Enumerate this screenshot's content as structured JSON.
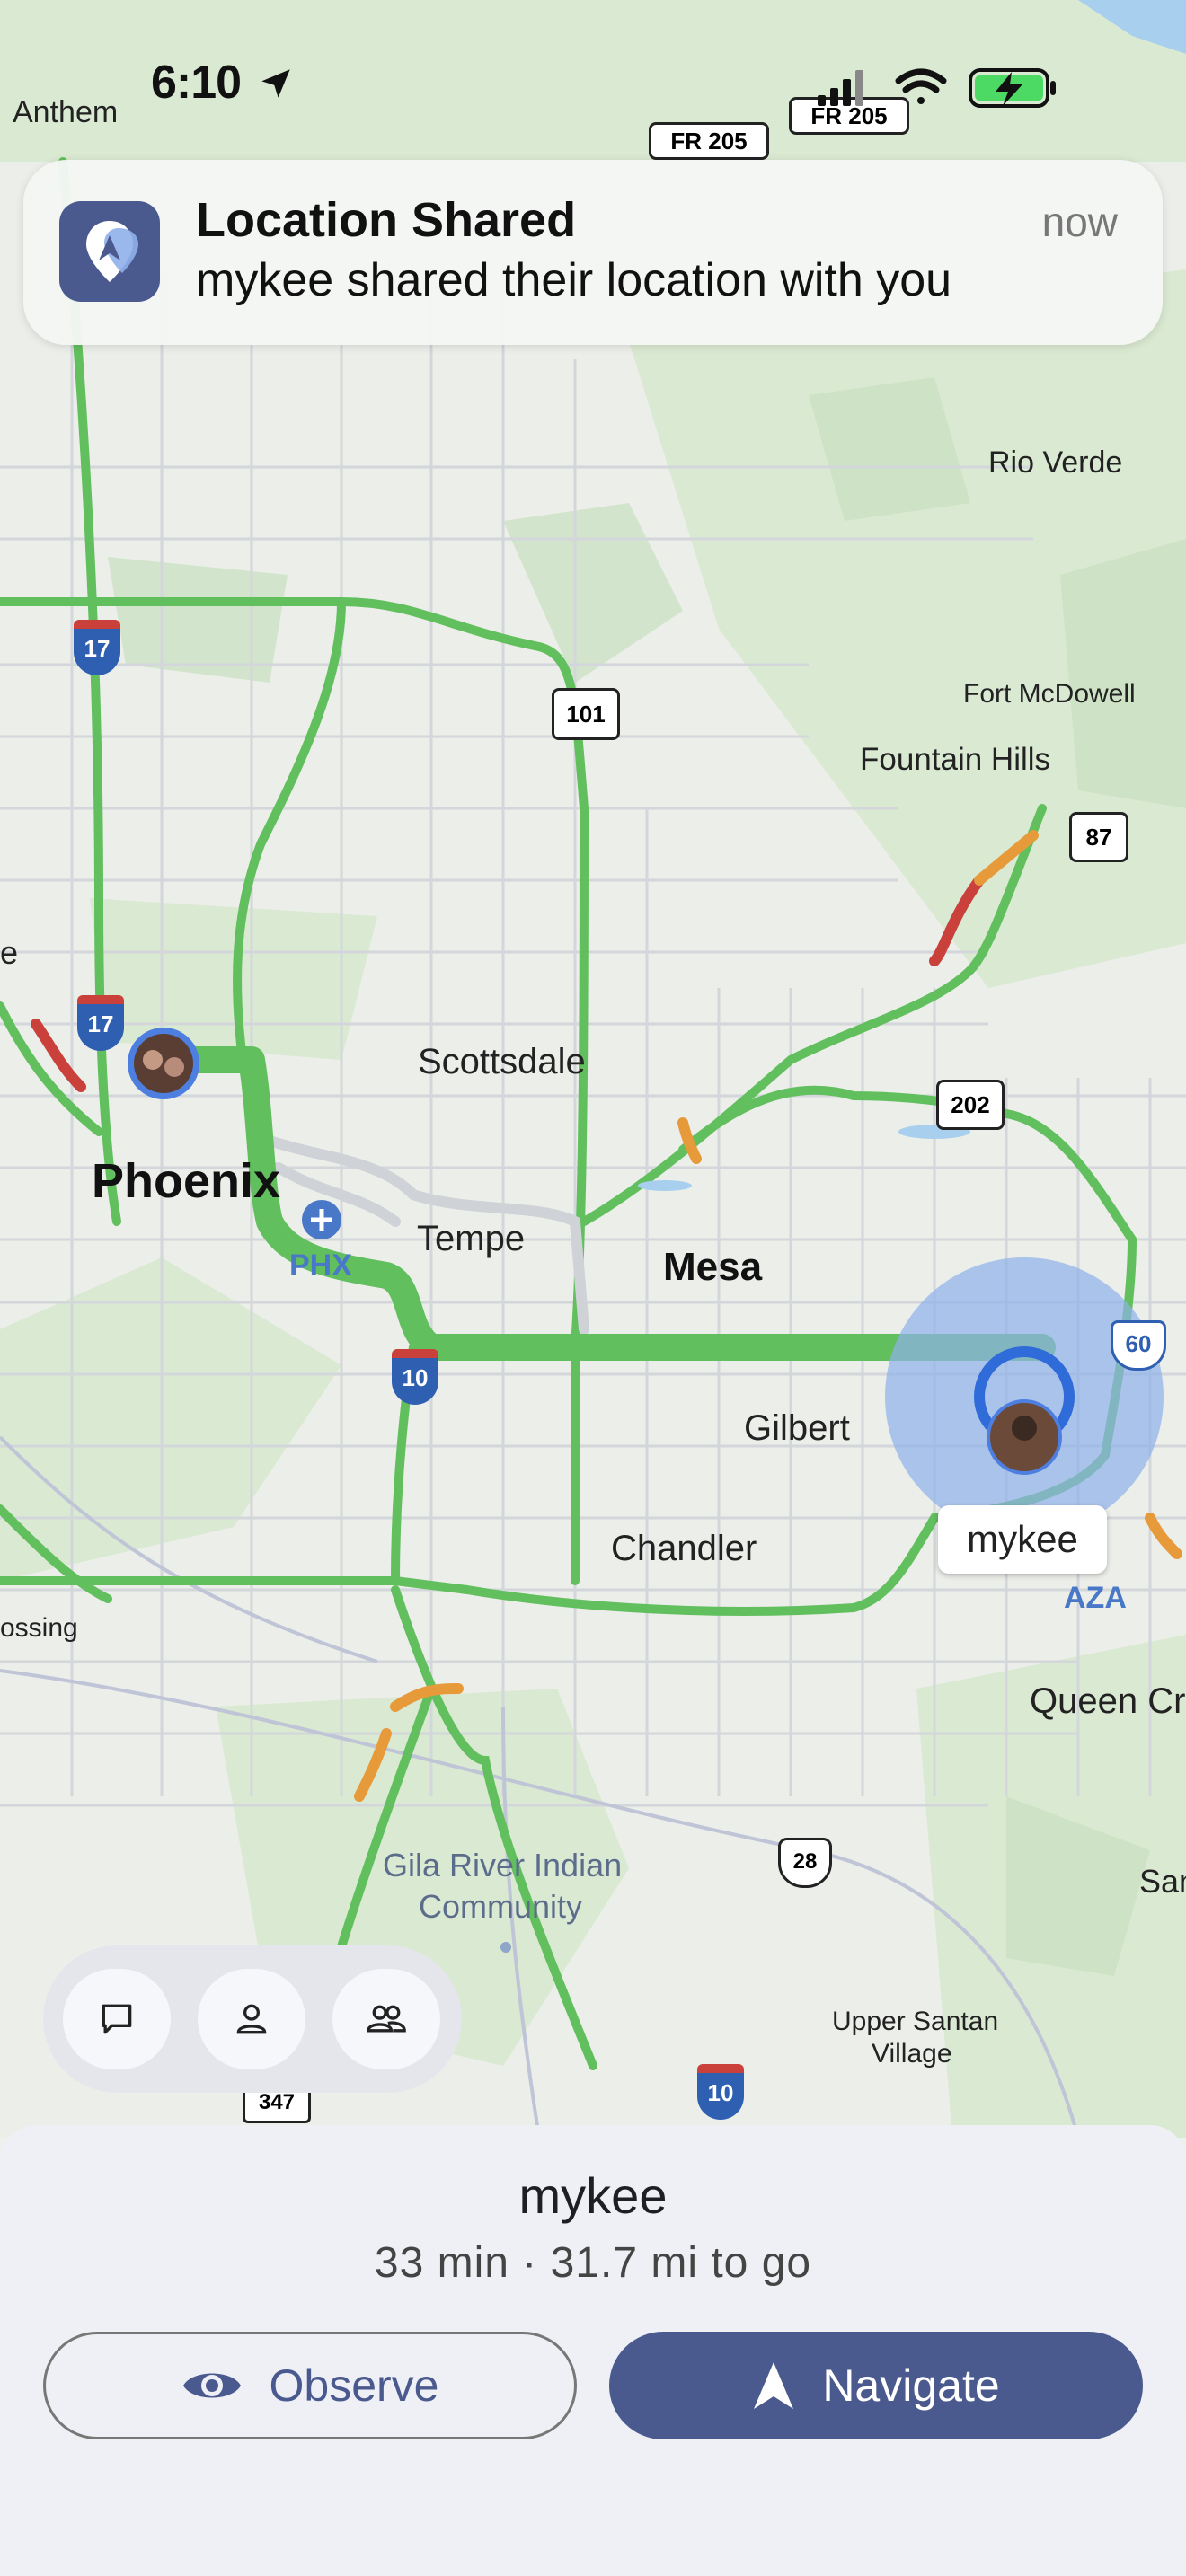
{
  "status_bar": {
    "time": "6:10"
  },
  "notification": {
    "title": "Location Shared",
    "body": "mykee shared their location with you",
    "time": "now",
    "icon": "location-pin-icon"
  },
  "map": {
    "places": {
      "anthem": "Anthem",
      "rio_verde": "Rio Verde",
      "fort_mcdowell": "Fort McDowell",
      "fountain_hills": "Fountain Hills",
      "scottsdale": "Scottsdale",
      "phoenix": "Phoenix",
      "tempe": "Tempe",
      "mesa": "Mesa",
      "gilbert": "Gilbert",
      "chandler": "Chandler",
      "queen_creek": "Queen Cr",
      "gila_river_1": "Gila River Indian",
      "gila_river_2": "Community",
      "upper_santan_1": "Upper Santan",
      "upper_santan_2": "Village",
      "e_partial": "e",
      "ossing_partial": "ossing",
      "san_partial": "San"
    },
    "airports": {
      "phx": "PHX",
      "aza": "AZA"
    },
    "shields": {
      "fr205a": "FR 205",
      "fr205b": "FR 205",
      "i17a": "17",
      "i17b": "17",
      "r101": "101",
      "r87": "87",
      "r202": "202",
      "us60": "60",
      "i10a": "10",
      "i10b": "10",
      "r28": "28",
      "r347": "347"
    },
    "tracked_user_label": "mykee"
  },
  "toolbar": {
    "chat_icon": "chat-bubble-icon",
    "person_icon": "person-icon",
    "group_icon": "group-icon"
  },
  "sheet": {
    "name": "mykee",
    "eta": "33 min · 31.7 mi to go",
    "observe_label": "Observe",
    "navigate_label": "Navigate"
  },
  "colors": {
    "accent": "#4a5a8e",
    "route_green": "#62bf5e",
    "traffic_red": "#c9413a",
    "traffic_orange": "#e79a3a",
    "user_halo": "#8fb0ea"
  }
}
